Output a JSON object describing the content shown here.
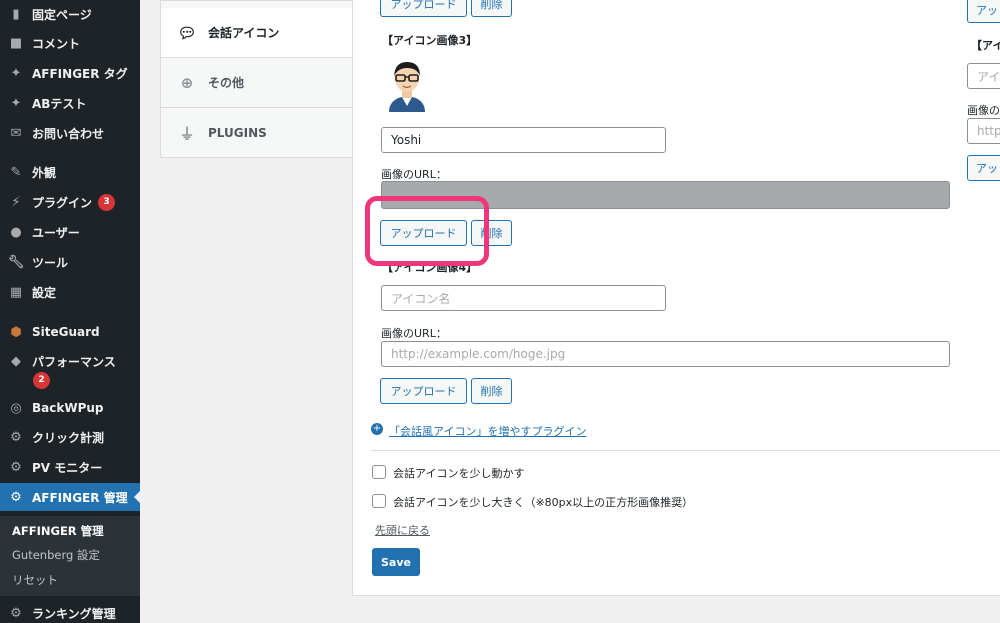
{
  "sidebar": {
    "items": [
      {
        "label": "固定ページ",
        "icon": "page-icon"
      },
      {
        "label": "コメント",
        "icon": "comment-icon"
      },
      {
        "label": "AFFINGER タグ",
        "icon": "pin-icon"
      },
      {
        "label": "ABテスト",
        "icon": "pin-icon"
      },
      {
        "label": "お問い合わせ",
        "icon": "mail-icon"
      },
      {
        "label": "外観",
        "icon": "brush-icon"
      },
      {
        "label": "プラグイン",
        "icon": "plugin-icon",
        "badge": "3"
      },
      {
        "label": "ユーザー",
        "icon": "user-icon"
      },
      {
        "label": "ツール",
        "icon": "wrench-icon"
      },
      {
        "label": "設定",
        "icon": "settings-icon"
      },
      {
        "label": "SiteGuard",
        "icon": "shield-icon"
      },
      {
        "label": "パフォーマンス",
        "icon": "cube-icon",
        "badge": "2"
      },
      {
        "label": "BackWPup",
        "icon": "backup-icon"
      },
      {
        "label": "クリック計測",
        "icon": "gear-icon"
      },
      {
        "label": "PV モニター",
        "icon": "gear-icon"
      },
      {
        "label": "AFFINGER 管理",
        "icon": "gear-icon"
      },
      {
        "label": "ランキング管理",
        "icon": "gear-icon"
      }
    ],
    "submenu": [
      "AFFINGER 管理",
      "Gutenberg 設定",
      "リセット"
    ]
  },
  "tabs": [
    {
      "label": "会話アイコン",
      "icon": "speech-bubble-icon"
    },
    {
      "label": "その他",
      "icon": "plus-circle-icon"
    },
    {
      "label": "PLUGINS",
      "icon": "plug-icon"
    }
  ],
  "main": {
    "top_upload": "アップロード",
    "top_delete": "削除",
    "heading3": "【アイコン画像3】",
    "name3": "Yoshi",
    "url_label": "画像のURL：",
    "upload3": "アップロード",
    "delete3": "削除",
    "heading4": "【アイコン画像4】",
    "name_placeholder": "アイコン名",
    "url_placeholder": "http://example.com/hoge.jpg",
    "upload4": "アップロード",
    "delete4": "削除",
    "plugin_link": "「会話風アイコン」を増やすプラグイン",
    "check1": "会話アイコンを少し動かす",
    "check2": "会話アイコンを少し大きく（※80px以上の正方形画像推奨）",
    "back_top": "先頭に戻る",
    "save": "Save"
  },
  "right_col": {
    "heading": "【アイ",
    "input_value": "アイ",
    "url_label": "画像の",
    "url_value": "http:",
    "button": "アッ"
  },
  "colors": {
    "sidebar_bg": "#1d2327",
    "accent": "#2271b1",
    "highlight": "#f0367a",
    "badge": "#d63638"
  }
}
